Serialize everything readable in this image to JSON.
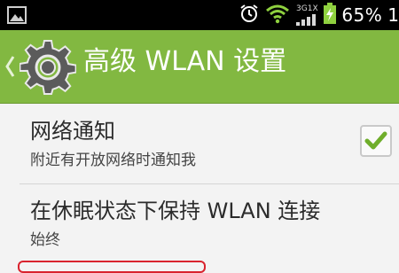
{
  "status_bar": {
    "icons": [
      "gallery-icon",
      "alarm-clock-icon",
      "wifi-icon",
      "network-3g-1x-icon",
      "battery-charging-icon"
    ],
    "network_label_top": "3G1X",
    "battery_percent": "65%",
    "time_partial": "1",
    "colors": {
      "background": "#000000",
      "wifi": "#8fd13f",
      "battery": "#8fd13f"
    }
  },
  "action_bar": {
    "title": "高级 WLAN 设置",
    "icons": [
      "back-chevron-icon",
      "settings-gear-icon"
    ],
    "colors": {
      "background": "#82b841",
      "text": "#ffffff"
    }
  },
  "settings": [
    {
      "title": "网络通知",
      "summary": "附近有开放网络时通知我",
      "checked": true
    },
    {
      "title": "在休眠状态下保持 WLAN 连接",
      "summary": "始终"
    }
  ],
  "colors": {
    "accent": "#82b841",
    "check": "#6fae2b",
    "highlight_border": "#d9232e"
  }
}
